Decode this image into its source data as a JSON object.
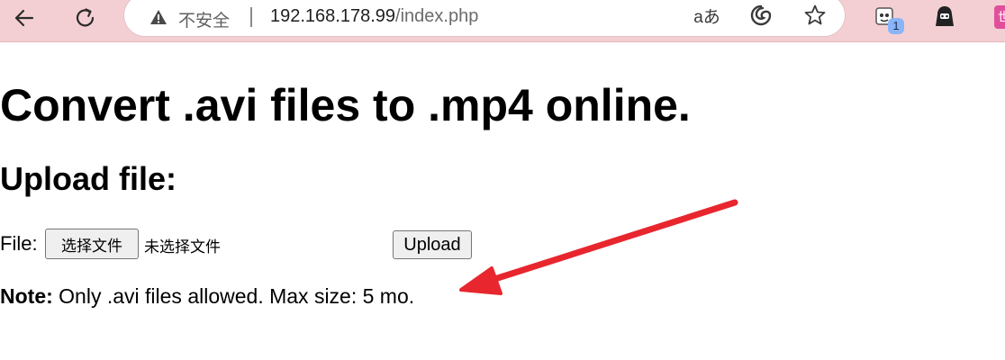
{
  "browser": {
    "not_secure_label": "不安全",
    "url_host": "192.168.178.99",
    "url_path": "/index.php",
    "read_aloud_label": "aあ",
    "extension_badge": "1",
    "extension_last_label": "世"
  },
  "page": {
    "title": "Convert .avi files to .mp4 online.",
    "upload_heading": "Upload file:",
    "file_label": "File:",
    "choose_file_label": "选择文件",
    "no_file_text": "未选择文件",
    "upload_label": "Upload",
    "note_label": "Note:",
    "note_text": " Only .avi files allowed. Max size: 5 mo."
  },
  "annotation": {
    "arrow_color": "#e8262e"
  },
  "icons": [
    "back-arrow-icon",
    "refresh-icon",
    "warning-icon",
    "read-aloud-icon",
    "edge-copilot-icon",
    "favorite-star-icon",
    "extension-icon",
    "profile-icon"
  ]
}
